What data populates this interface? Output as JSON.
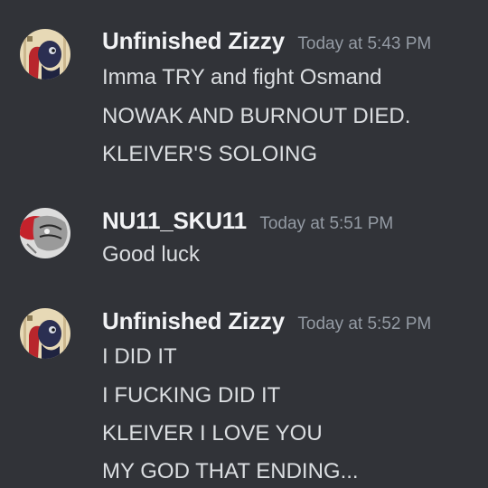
{
  "messages": [
    {
      "username": "Unfinished Zizzy",
      "timestamp": "Today at 5:43 PM",
      "avatar_icon": "zizzy-avatar-icon",
      "lines": [
        "Imma TRY and fight Osmand",
        "NOWAK AND BURNOUT DIED.",
        "KLEIVER'S SOLOING"
      ]
    },
    {
      "username": "NU11_SKU11",
      "timestamp": "Today at 5:51 PM",
      "avatar_icon": "sku11-avatar-icon",
      "lines": [
        "Good luck"
      ]
    },
    {
      "username": "Unfinished Zizzy",
      "timestamp": "Today at 5:52 PM",
      "avatar_icon": "zizzy-avatar-icon",
      "lines": [
        "I DID IT",
        "I FUCKING DID IT",
        "KLEIVER I LOVE YOU",
        "MY GOD THAT ENDING..."
      ]
    }
  ],
  "colors": {
    "background": "#313338",
    "username": "#f2f3f5",
    "timestamp": "#949ba4",
    "message_text": "#dbdee1"
  }
}
